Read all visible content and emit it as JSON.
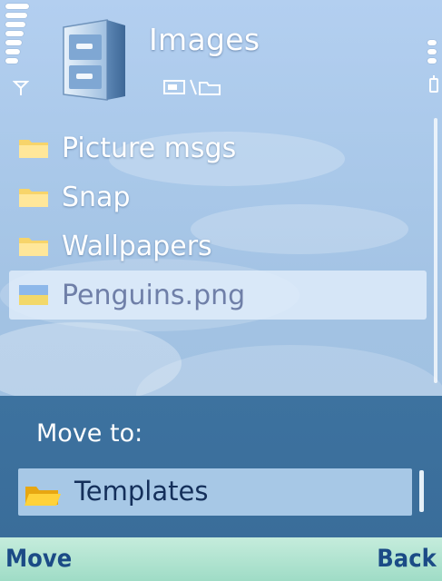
{
  "header": {
    "title": "Images",
    "icon": "file-cabinet-icon",
    "mode_icons": "memory-and-folder-icons"
  },
  "list": {
    "items": [
      {
        "label": "Picture msgs",
        "icon": "folder-icon",
        "selected": false
      },
      {
        "label": "Snap",
        "icon": "folder-icon",
        "selected": false
      },
      {
        "label": "Wallpapers",
        "icon": "folder-icon",
        "selected": false
      },
      {
        "label": "Penguins.png",
        "icon": "image-file-icon",
        "selected": true
      }
    ]
  },
  "popup": {
    "label": "Move to:",
    "target": "Templates",
    "target_icon": "folder-open-icon"
  },
  "softkeys": {
    "left": "Move",
    "right": "Back"
  },
  "colors": {
    "background": "#a9c8e9",
    "popup": "#3d729f",
    "field": "#a7c8e6",
    "softkey_text": "#1b4b86",
    "softkey_bg": "#b0e3cf"
  }
}
